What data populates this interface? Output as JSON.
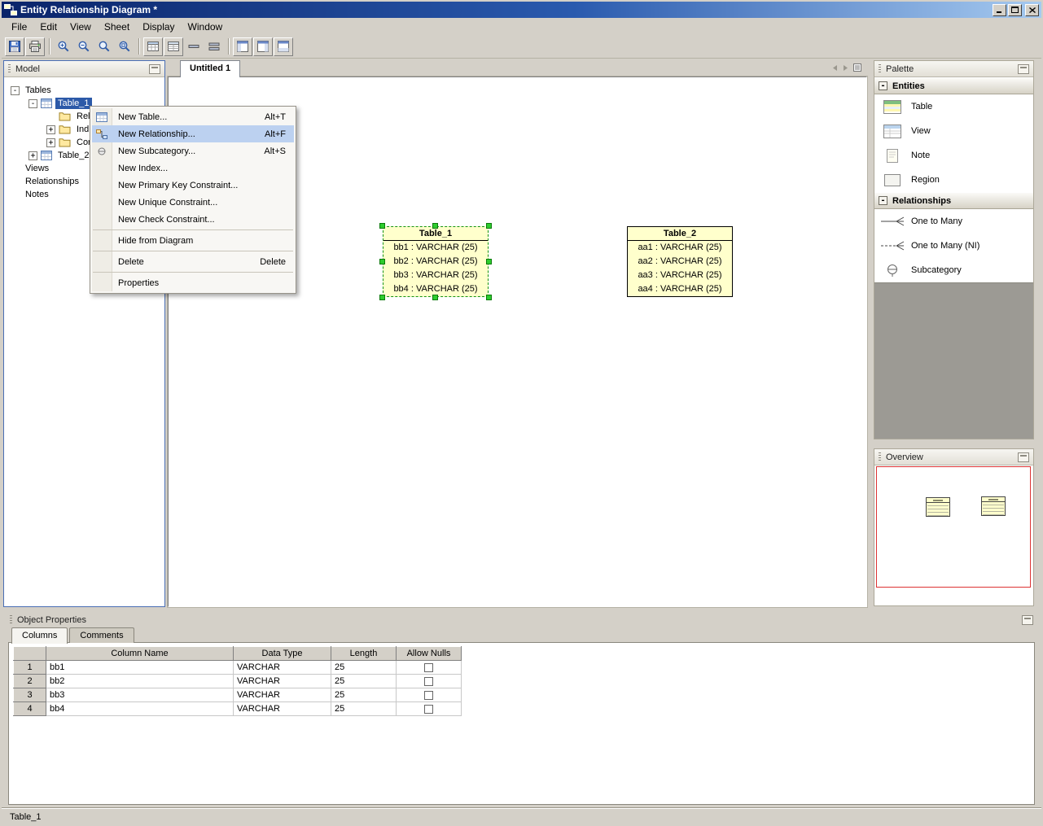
{
  "colors": {
    "titlebar_left": "#0A246A",
    "titlebar_right": "#A6CAF0",
    "window_chrome": "#D4D0C8",
    "table_fill": "#FFFFCC",
    "selection_green": "#2ECC2E",
    "menu_highlight": "#BCD1F0",
    "tree_selection": "#2C59A8",
    "overview_viewport": "#DD3333",
    "palette_empty": "#9C9A94"
  },
  "window": {
    "title": "Entity Relationship Diagram *",
    "controls": [
      "minimize",
      "maximize",
      "close"
    ]
  },
  "menu": {
    "items": [
      "File",
      "Edit",
      "View",
      "Sheet",
      "Display",
      "Window"
    ]
  },
  "toolbar": {
    "icons": [
      "save-icon",
      "print-icon",
      "zoom-in-icon",
      "zoom-out-icon",
      "zoom-normal-icon",
      "zoom-page-icon",
      "table-grid-icon",
      "table-columns-icon",
      "collapse-bar-icon",
      "collapse-bars-icon",
      "window-layout-left-icon",
      "window-layout-right-icon",
      "window-layout-bottom-icon"
    ]
  },
  "model_panel": {
    "title": "Model",
    "header_icon": "undock-icon",
    "tree": [
      {
        "label": "Tables",
        "expander": "minus"
      },
      {
        "label": "Table_1",
        "expander": "minus",
        "icon": "table-icon",
        "selected": true
      },
      {
        "label": "Rel",
        "icon": "folder-icon"
      },
      {
        "label": "Ind",
        "expander": "plus",
        "icon": "folder-icon"
      },
      {
        "label": "Cor",
        "expander": "plus",
        "icon": "folder-icon"
      },
      {
        "label": "Table_2",
        "expander": "plus",
        "icon": "table-icon"
      },
      {
        "label": "Views"
      },
      {
        "label": "Relationships"
      },
      {
        "label": "Notes"
      }
    ]
  },
  "context_menu": {
    "items": [
      {
        "label": "New Table...",
        "shortcut": "Alt+T",
        "icon": "table-icon"
      },
      {
        "label": "New Relationship...",
        "shortcut": "Alt+F",
        "icon": "relationship-icon",
        "highlighted": true
      },
      {
        "label": "New Subcategory...",
        "shortcut": "Alt+S",
        "icon": "subcategory-icon"
      },
      {
        "label": "New Index...",
        "shortcut": ""
      },
      {
        "label": "New Primary Key Constraint...",
        "shortcut": ""
      },
      {
        "label": "New Unique Constraint...",
        "shortcut": ""
      },
      {
        "label": "New Check Constraint...",
        "shortcut": ""
      },
      {
        "label": "Hide from Diagram",
        "shortcut": ""
      },
      {
        "label": "Delete",
        "shortcut": "Delete"
      },
      {
        "label": "Properties",
        "shortcut": ""
      }
    ]
  },
  "sheet": {
    "tab": "Untitled 1",
    "nav_icons": [
      "prev-sheet-icon",
      "next-sheet-icon",
      "sheet-list-icon"
    ],
    "tables": [
      {
        "name": "Table_1",
        "selected": true,
        "columns": [
          "bb1 : VARCHAR (25)",
          "bb2 : VARCHAR (25)",
          "bb3 : VARCHAR (25)",
          "bb4 : VARCHAR (25)"
        ]
      },
      {
        "name": "Table_2",
        "selected": false,
        "columns": [
          "aa1 : VARCHAR (25)",
          "aa2 : VARCHAR (25)",
          "aa3 : VARCHAR (25)",
          "aa4 : VARCHAR (25)"
        ]
      }
    ]
  },
  "palette": {
    "title": "Palette",
    "header_icon": "undock-icon",
    "groups": [
      {
        "title": "Entities",
        "items": [
          {
            "label": "Table",
            "icon": "table-entity-icon"
          },
          {
            "label": "View",
            "icon": "view-entity-icon"
          },
          {
            "label": "Note",
            "icon": "note-icon"
          },
          {
            "label": "Region",
            "icon": "region-icon"
          }
        ]
      },
      {
        "title": "Relationships",
        "items": [
          {
            "label": "One to Many",
            "icon": "one-to-many-icon"
          },
          {
            "label": "One to Many (NI)",
            "icon": "one-to-many-ni-icon"
          },
          {
            "label": "Subcategory",
            "icon": "subcategory-icon"
          }
        ]
      }
    ]
  },
  "overview": {
    "title": "Overview",
    "header_icon": "undock-icon"
  },
  "object_properties": {
    "title": "Object Properties",
    "header_icon": "undock-icon",
    "tabs": [
      "Columns",
      "Comments"
    ],
    "active_tab": "Columns",
    "grid": {
      "headers": [
        "Column Name",
        "Data Type",
        "Length",
        "Allow Nulls"
      ],
      "rows": [
        {
          "num": "1",
          "column_name": "bb1",
          "data_type": "VARCHAR",
          "length": "25",
          "allow_nulls": false
        },
        {
          "num": "2",
          "column_name": "bb2",
          "data_type": "VARCHAR",
          "length": "25",
          "allow_nulls": false
        },
        {
          "num": "3",
          "column_name": "bb3",
          "data_type": "VARCHAR",
          "length": "25",
          "allow_nulls": false
        },
        {
          "num": "4",
          "column_name": "bb4",
          "data_type": "VARCHAR",
          "length": "25",
          "allow_nulls": false
        }
      ]
    }
  },
  "status_bar": {
    "text": "Table_1"
  }
}
